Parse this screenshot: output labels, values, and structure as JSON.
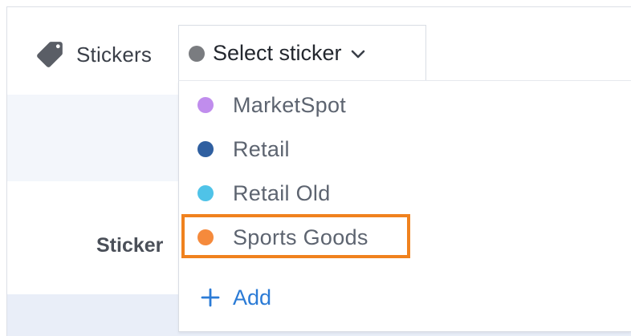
{
  "header": {
    "stickers_label": "Stickers",
    "select_placeholder": "Select sticker",
    "select_dot_color": "#7a7c80"
  },
  "dropdown": {
    "items": [
      {
        "label": "MarketSpot",
        "color": "#c08ded"
      },
      {
        "label": "Retail",
        "color": "#2f5fa0"
      },
      {
        "label": "Retail Old",
        "color": "#4fc3e8"
      },
      {
        "label": "Sports Goods",
        "color": "#f58a3c",
        "highlighted": true
      }
    ],
    "add_label": "Add",
    "add_color": "#2b7bd6"
  },
  "background": {
    "field_label": "Sticker"
  },
  "colors": {
    "highlight": "#f0821e"
  },
  "icons": {
    "tag": "tag-icon",
    "chevron": "chevron-down-icon",
    "plus": "plus-icon",
    "edit": "pencil-icon"
  }
}
